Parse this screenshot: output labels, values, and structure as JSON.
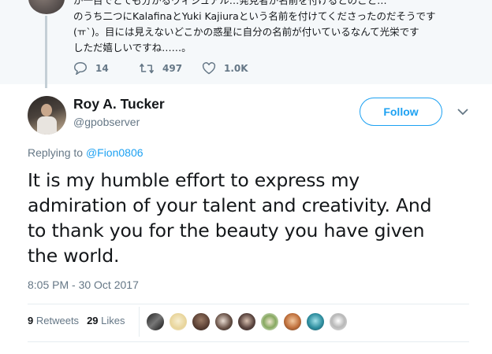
{
  "parent_tweet": {
    "text_lines": [
      "が一目でとても分かるヴィジュアル…発見者が名前を付けるとのこと…",
      "のうち二つにKalafinaとYuki Kajiuraという名前を付けてくださったのだそうです",
      "(ㅠ`)。目には見えないどこかの惑星に自分の名前が付いているなんて光栄です",
      "しただ嬉しいですね……。"
    ],
    "replies": "14",
    "retweets": "497",
    "likes": "1.0K"
  },
  "tweet": {
    "display_name": "Roy A. Tucker",
    "handle": "@gpobserver",
    "follow_label": "Follow",
    "replying_to_label": "Replying to",
    "replying_to_handle": "@Fion0806",
    "text_lines": [
      "It is my humble effort to express my",
      "admiration of your talent and creativity. And",
      "to thank you for the beauty you have given",
      "the world."
    ],
    "timestamp": "8:05 PM - 30 Oct 2017",
    "retweets_count": "9",
    "retweets_label": "Retweets",
    "likes_count": "29",
    "likes_label": "Likes"
  },
  "icons": {
    "reply": "reply-icon",
    "retweet": "retweet-icon",
    "like": "heart-icon",
    "more": "chevron-down-icon"
  },
  "colors": {
    "accent": "#1da1f2",
    "secondary_text": "#657786",
    "parent_bg": "#f5f8fa"
  }
}
